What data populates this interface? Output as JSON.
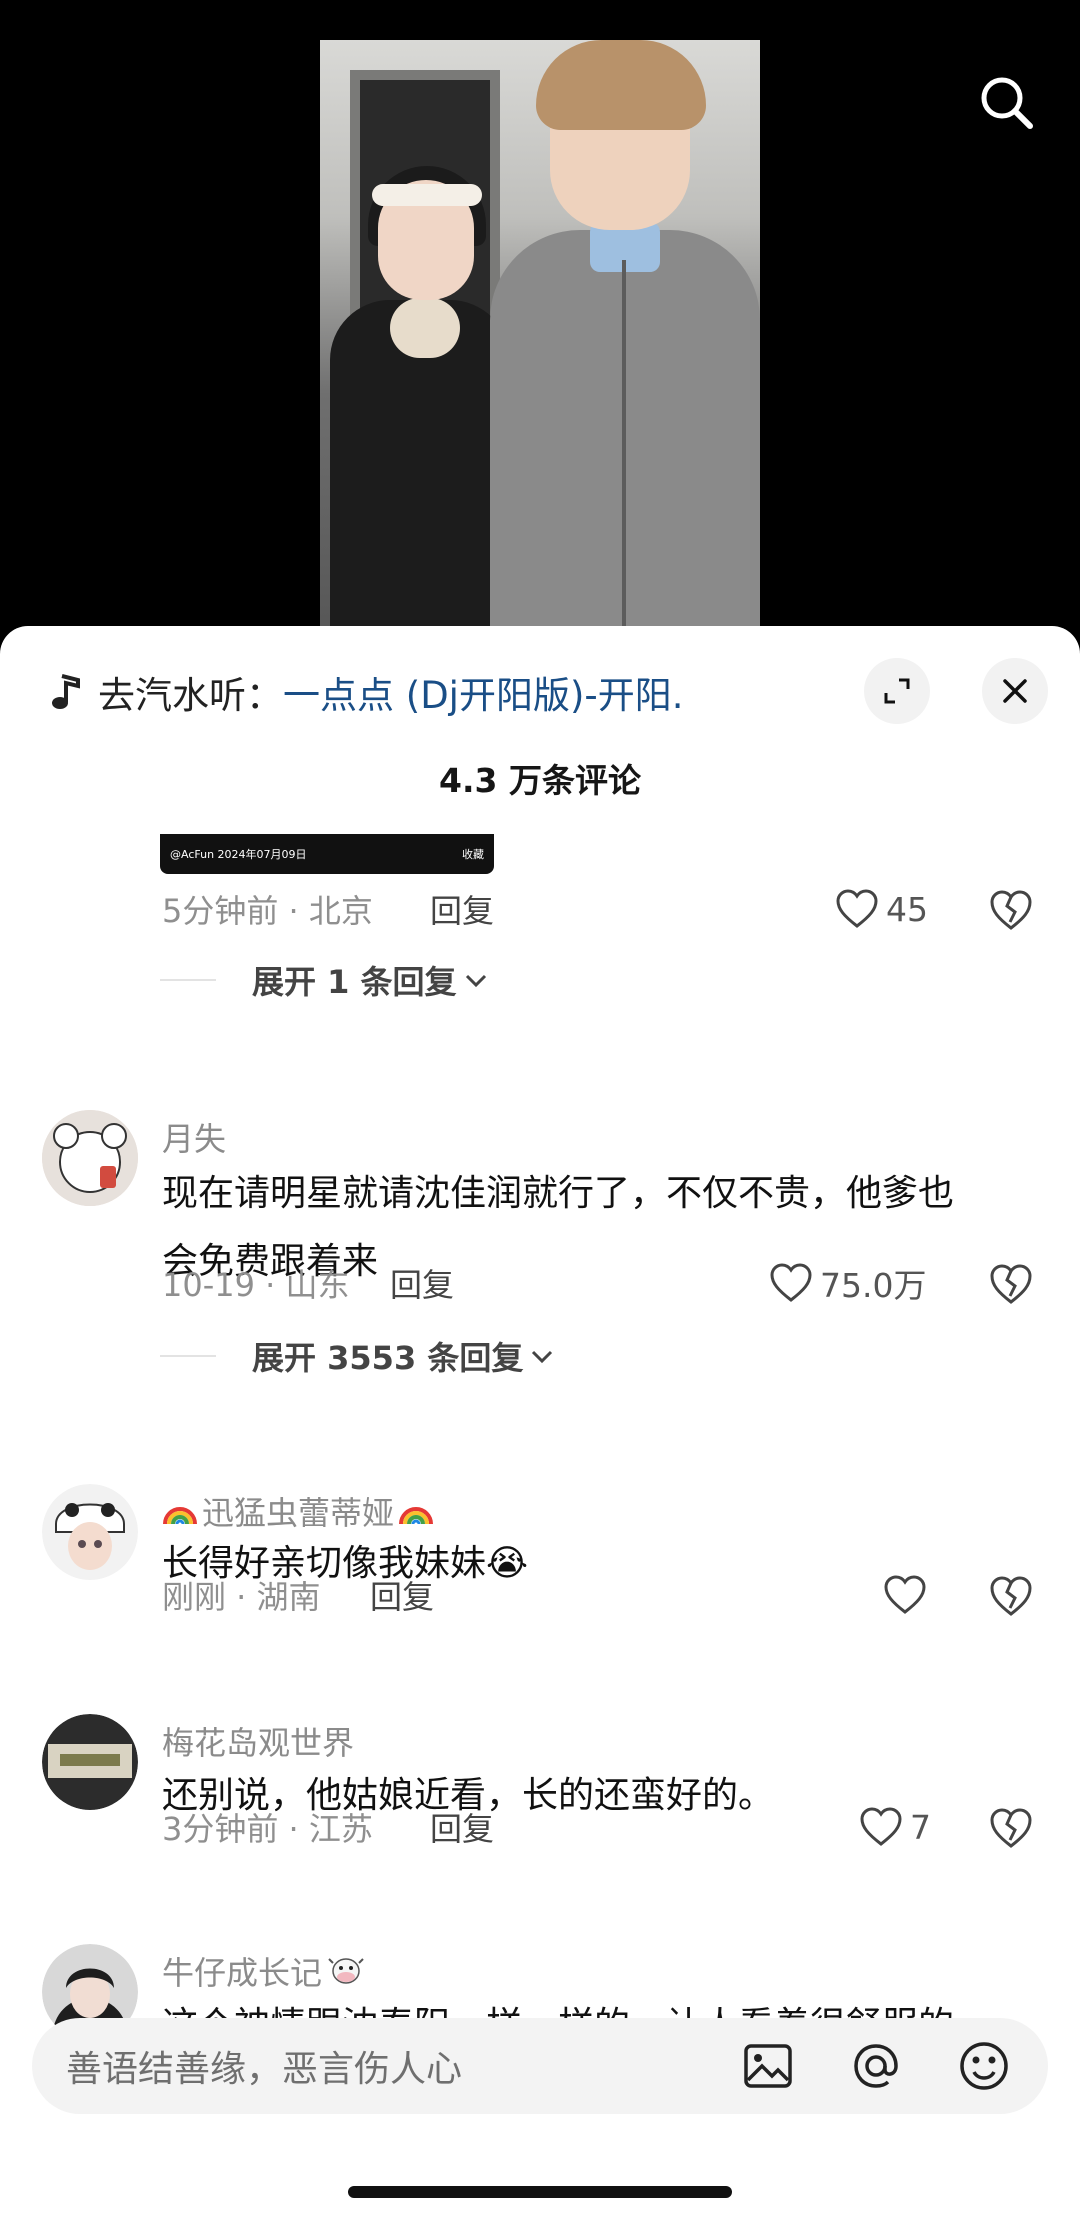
{
  "top_bar": {
    "search_icon": "search-icon"
  },
  "music": {
    "prefix": "去汽水听：",
    "song": "一点点 (Dj开阳版)-开阳."
  },
  "comments_title": "4.3 万条评论",
  "snippet": {
    "left": "@AcFun  2024年07月09日",
    "right": "收藏"
  },
  "comments": [
    {
      "time_location": "5分钟前 · 北京",
      "reply_label": "回复",
      "likes": "45",
      "expand": "展开 1 条回复"
    },
    {
      "name": "月失",
      "text_line1": "现在请明星就请沈佳润就行了，不仅不贵，他爹也",
      "text_line2": "会免费跟着来",
      "time_location": "10-19 · 山东",
      "reply_label": "回复",
      "likes": "75.0万",
      "expand": "展开 3553 条回复"
    },
    {
      "name": "迅猛虫蕾蒂娅",
      "text": "长得好亲切像我妹妹",
      "emoji": "😭",
      "time_location": "刚刚 · 湖南",
      "reply_label": "回复",
      "likes": ""
    },
    {
      "name": "梅花岛观世界",
      "text": "还别说，他姑娘近看，长的还蛮好的。",
      "time_location": "3分钟前 · 江苏",
      "reply_label": "回复",
      "likes": "7"
    },
    {
      "name": "牛仔成长记",
      "text": "这个神情跟沈春阳一样一样的，让人看着很舒服的"
    }
  ],
  "input": {
    "placeholder": "善语结善缘，恶言伤人心"
  }
}
